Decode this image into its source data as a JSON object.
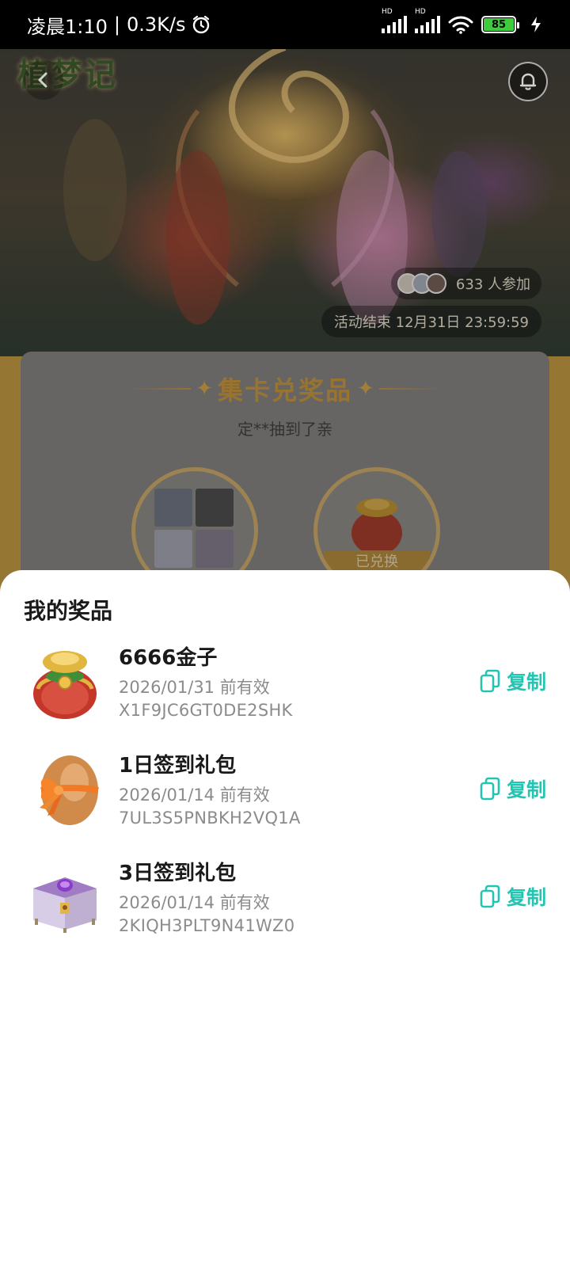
{
  "status_bar": {
    "time": "凌晨1:10",
    "separator": "|",
    "network_speed": "0.3K/s",
    "alarm_icon": "alarm-clock-icon",
    "signal_1_label": "HD",
    "signal_2_label": "HD",
    "wifi_icon": "wifi-icon",
    "battery_level": "85",
    "charging_icon": "charging-bolt-icon"
  },
  "header": {
    "game_logo": "植梦记",
    "back_icon": "chevron-left-icon",
    "bell_icon": "bell-icon",
    "participants": "633 人参加",
    "end_time": "活动结束 12月31日 23:59:59"
  },
  "card": {
    "title": "集卡兑奖品",
    "subtitle": "定**抽到了亲",
    "redeemed_label": "已兑换"
  },
  "sheet": {
    "title": "我的奖品",
    "copy_icon": "copy-icon",
    "items": [
      {
        "name": "6666金子",
        "expiry": "2026/01/31 前有效",
        "code": "X1F9JC6GT0DE2SHK",
        "copy_label": "复制",
        "image": "gold-pouch-icon"
      },
      {
        "name": "1日签到礼包",
        "expiry": "2026/01/14 前有效",
        "code": "7UL3S5PNBKH2VQ1A",
        "copy_label": "复制",
        "image": "gift-egg-icon"
      },
      {
        "name": "3日签到礼包",
        "expiry": "2026/01/14 前有效",
        "code": "2KIQH3PLT9N41WZ0",
        "copy_label": "复制",
        "image": "treasure-chest-icon"
      }
    ]
  },
  "colors": {
    "accent": "#23c4b2",
    "gold": "#bb8d3b",
    "battery": "#3ecb3e"
  }
}
